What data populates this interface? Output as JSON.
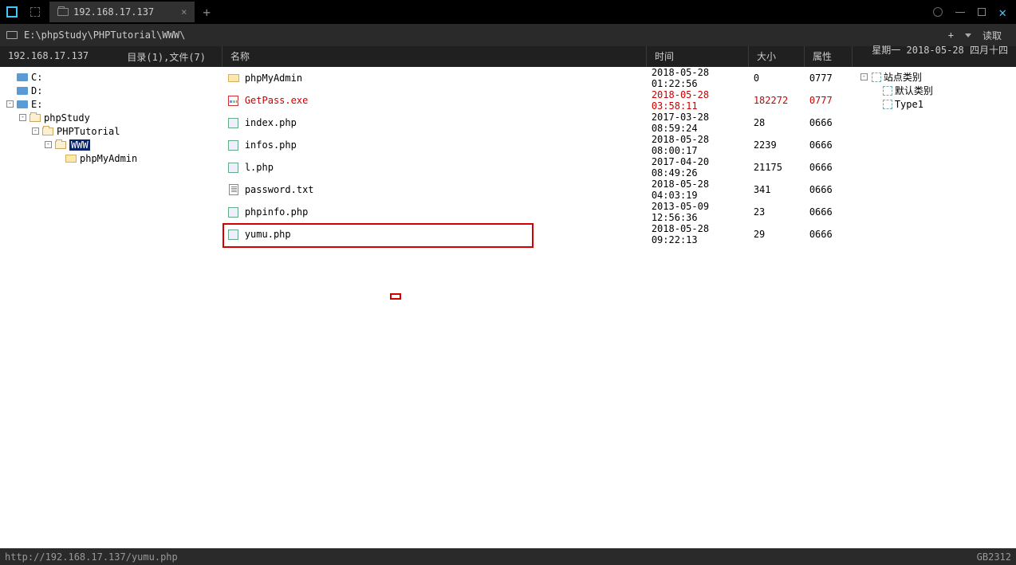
{
  "tab": {
    "title": "192.168.17.137"
  },
  "path": "E:\\phpStudy\\PHPTutorial\\WWW\\",
  "path_actions": {
    "plus": "+",
    "read": "读取"
  },
  "date_info": "星期一 2018-05-28 四月十四",
  "header": {
    "ip": "192.168.17.137",
    "counts": "目录(1),文件(7)",
    "cols": {
      "name": "名称",
      "time": "时间",
      "size": "大小",
      "perm": "属性"
    }
  },
  "tree": {
    "c": "C:",
    "d": "D:",
    "e": "E:",
    "phpstudy": "phpStudy",
    "tutorial": "PHPTutorial",
    "www": "WWW",
    "phpmyadmin": "phpMyAdmin"
  },
  "files": [
    {
      "name": "phpMyAdmin",
      "time": "2018-05-28 01:22:56",
      "size": "0",
      "perm": "0777",
      "type": "folder",
      "red": false
    },
    {
      "name": "GetPass.exe",
      "time": "2018-05-28 03:58:11",
      "size": "182272",
      "perm": "0777",
      "type": "exe",
      "red": true
    },
    {
      "name": "index.php",
      "time": "2017-03-28 08:59:24",
      "size": "28",
      "perm": "0666",
      "type": "php",
      "red": false
    },
    {
      "name": "infos.php",
      "time": "2018-05-28 08:00:17",
      "size": "2239",
      "perm": "0666",
      "type": "php",
      "red": false
    },
    {
      "name": "l.php",
      "time": "2017-04-20 08:49:26",
      "size": "21175",
      "perm": "0666",
      "type": "php",
      "red": false
    },
    {
      "name": "password.txt",
      "time": "2018-05-28 04:03:19",
      "size": "341",
      "perm": "0666",
      "type": "txt",
      "red": false
    },
    {
      "name": "phpinfo.php",
      "time": "2013-05-09 12:56:36",
      "size": "23",
      "perm": "0666",
      "type": "php",
      "red": false
    },
    {
      "name": "yumu.php",
      "time": "2018-05-28 09:22:13",
      "size": "29",
      "perm": "0666",
      "type": "php",
      "red": false,
      "boxed": true
    }
  ],
  "categories": {
    "root": "站点类别",
    "default": "默认类别",
    "type1": "Type1"
  },
  "status": {
    "url": "http://192.168.17.137/yumu.php",
    "enc": "GB2312"
  }
}
